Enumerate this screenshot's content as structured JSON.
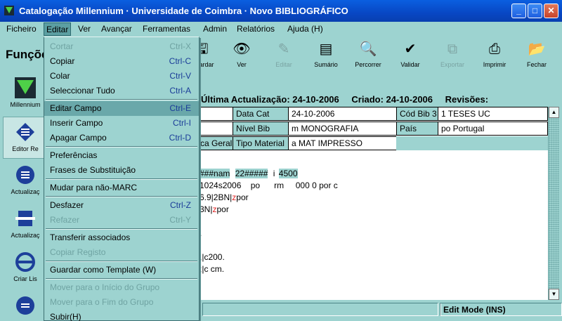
{
  "window": {
    "title": "Catalogação Millennium · Universidade de Coimbra · Novo BIBLIOGRÁFICO",
    "minimize": "_",
    "maximize": "□",
    "close": "✕"
  },
  "menubar": [
    "Ficheiro",
    "Editar",
    "Ver",
    "Avançar",
    "Ferramentas",
    "Admin",
    "Relatórios",
    "Ajuda (H)"
  ],
  "funcoes_label": "Funções",
  "toolbar": {
    "guardar": "Guardar",
    "ver": "Ver",
    "editar": "Editar",
    "sumario": "Sumário",
    "percorrer": "Percorrer",
    "validar": "Validar",
    "exportar": "Exportar",
    "imprimir": "Imprimir",
    "fechar": "Fechar"
  },
  "sidebar": [
    "Millennium",
    "Editor Re",
    "Actualizaç",
    "Actualizaç",
    "Criar Lis"
  ],
  "record_header": {
    "last_update": "Última Actualização: 24-10-2006",
    "created": "Criado: 24-10-2006",
    "revisions": "Revisões:"
  },
  "grid": {
    "data_cat_label": "Data Cat",
    "data_cat_value": "24-10-2006",
    "cod_bib3_label": "Cód Bib 3",
    "cod_bib3_value": "1   TESES UC",
    "nivel_bib_label": "Nível Bib",
    "nivel_bib_value": "m   MONOGRAFIA",
    "pais_label": "País",
    "pais_value": "po    Portugal",
    "tipo_material_label": "Tipo Material",
    "tipo_material_value": "a   MAT IMPRESSO",
    "left_fragment": "ca Geral"
  },
  "marc": {
    "l1a": "###nam",
    "l1b": "22#####",
    "l1c": "i",
    "l1d": "4500",
    "l2": "1024s2006    po      rm     000 0 por c",
    "l3a": "6.9|2BN|",
    "l3b": "z",
    "l3c": "por",
    "l4a": "3N|",
    "l4b": "z",
    "l4c": "por",
    "l5": ".",
    "l6": ",|c200.",
    "l7": ";|c cm."
  },
  "status": {
    "edit_mode": "Edit Mode (INS)"
  },
  "edit_menu": {
    "cortar": "Cortar",
    "cortar_sc": "Ctrl-X",
    "copiar": "Copiar",
    "copiar_sc": "Ctrl-C",
    "colar": "Colar",
    "colar_sc": "Ctrl-V",
    "sel_tudo": "Seleccionar Tudo",
    "sel_tudo_sc": "Ctrl-A",
    "editar_campo": "Editar Campo",
    "editar_campo_sc": "Ctrl-E",
    "inserir_campo": "Inserir Campo",
    "inserir_campo_sc": "Ctrl-I",
    "apagar_campo": "Apagar Campo",
    "apagar_campo_sc": "Ctrl-D",
    "preferencias": "Preferências",
    "frases": "Frases de Substituição",
    "mudar": "Mudar para não-MARC",
    "desfazer": "Desfazer",
    "desfazer_sc": "Ctrl-Z",
    "refazer": "Refazer",
    "refazer_sc": "Ctrl-Y",
    "transferir": "Transferir associados",
    "copiar_registo": "Copiar Registo",
    "guardar_template": "Guardar como Template (W)",
    "mover_inicio": "Mover para o Início do Grupo",
    "mover_fim": "Mover para o Fim do Grupo",
    "subir": "Subir(H)"
  },
  "colors": {
    "background": "#9dd3d0",
    "titlebar": "#0847c4",
    "shortcut": "#1a3c98",
    "subfield_red": "#e02020"
  }
}
